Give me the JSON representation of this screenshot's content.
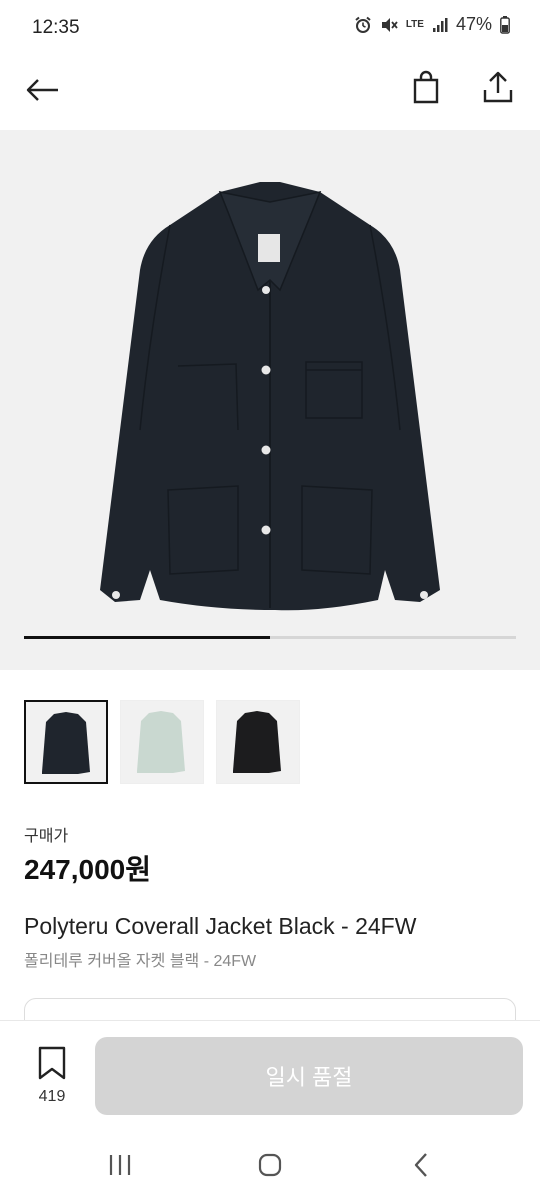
{
  "status_bar": {
    "time": "12:35",
    "lte": "LTE",
    "battery": "47%",
    "icons": [
      "alarm-icon",
      "mute-icon",
      "lte-icon",
      "signal-icon",
      "battery-icon"
    ]
  },
  "app_bar": {
    "icons": [
      "back-arrow-icon",
      "shopping-bag-icon",
      "share-icon"
    ]
  },
  "gallery": {
    "image_progress": 0.5,
    "thumbnails": [
      {
        "color": "#1f252d",
        "selected": true
      },
      {
        "color": "#c9d8d0",
        "selected": false
      },
      {
        "color": "#1c1c1e",
        "selected": false
      }
    ]
  },
  "product": {
    "price_label": "구매가",
    "price": "247,000원",
    "name_en": "Polyteru Coverall Jacket Black - 24FW",
    "name_ko": "폴리테루 커버올 자켓 블랙 - 24FW"
  },
  "bottom_bar": {
    "wishlist_count": "419",
    "buy_label": "일시 품절"
  },
  "nav_bar": {
    "icons": [
      "recent-apps-icon",
      "home-icon",
      "nav-back-icon"
    ]
  },
  "colors": {
    "jacket": "#1f252d",
    "disabled_button": "#d4d4d4",
    "image_background": "#f1f1f1"
  }
}
